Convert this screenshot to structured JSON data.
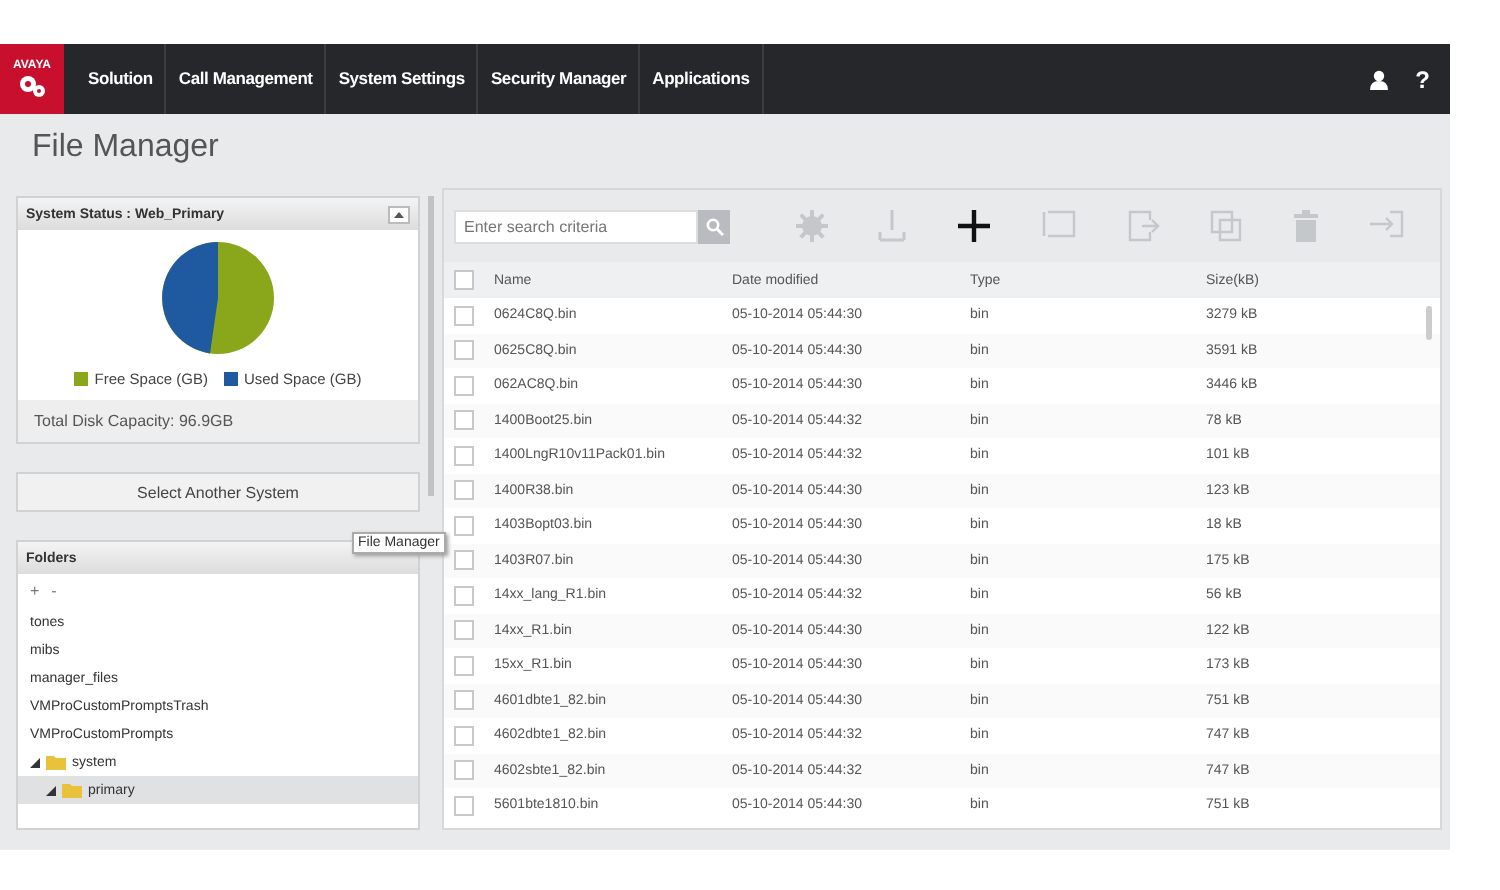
{
  "nav": {
    "logo": "AVAYA",
    "items": [
      "Solution",
      "Call Management",
      "System Settings",
      "Security Manager",
      "Applications"
    ],
    "help": "?"
  },
  "page_title": "File Manager",
  "status_panel": {
    "title": "System Status : Web_Primary",
    "legend": [
      {
        "label": "Free Space (GB)",
        "color": "#8aa61a"
      },
      {
        "label": "Used Space (GB)",
        "color": "#1f5aa0"
      }
    ],
    "total": "Total Disk Capacity: 96.9GB"
  },
  "select_button": "Select Another System",
  "folders": {
    "title": "Folders",
    "expand": "+",
    "collapse": "-",
    "items": [
      {
        "name": "tones",
        "selected": false
      },
      {
        "name": "mibs",
        "selected": false
      },
      {
        "name": "manager_files",
        "selected": false
      },
      {
        "name": "VMProCustomPromptsTrash",
        "selected": false
      },
      {
        "name": "VMProCustomPrompts",
        "selected": false
      },
      {
        "name": "system",
        "folder": true,
        "expanded": true,
        "selected": false,
        "children": [
          {
            "name": "primary",
            "folder": true,
            "expanded": true,
            "selected": true
          }
        ]
      }
    ]
  },
  "search": {
    "placeholder": "Enter search criteria"
  },
  "toolbar": [
    {
      "kind": "gear",
      "disabled": true
    },
    {
      "kind": "download",
      "disabled": true
    },
    {
      "kind": "add",
      "disabled": false
    },
    {
      "kind": "rename",
      "disabled": true
    },
    {
      "kind": "export",
      "disabled": true
    },
    {
      "kind": "copy",
      "disabled": true
    },
    {
      "kind": "delete",
      "disabled": true
    },
    {
      "kind": "logout",
      "disabled": true
    }
  ],
  "table": {
    "columns": [
      "Name",
      "Date modified",
      "Type",
      "Size(kB)"
    ],
    "header_checked": false,
    "rows": [
      {
        "name": "0624C8Q.bin",
        "date": "05-10-2014 05:44:30",
        "type": "bin",
        "size": "3279 kB",
        "checked": false
      },
      {
        "name": "0625C8Q.bin",
        "date": "05-10-2014 05:44:30",
        "type": "bin",
        "size": "3591 kB",
        "checked": false
      },
      {
        "name": "062AC8Q.bin",
        "date": "05-10-2014 05:44:30",
        "type": "bin",
        "size": "3446 kB",
        "checked": false
      },
      {
        "name": "1400Boot25.bin",
        "date": "05-10-2014 05:44:32",
        "type": "bin",
        "size": "78 kB",
        "checked": false
      },
      {
        "name": "1400LngR10v11Pack01.bin",
        "date": "05-10-2014 05:44:32",
        "type": "bin",
        "size": "101 kB",
        "checked": false
      },
      {
        "name": "1400R38.bin",
        "date": "05-10-2014 05:44:30",
        "type": "bin",
        "size": "123 kB",
        "checked": false
      },
      {
        "name": "1403Bopt03.bin",
        "date": "05-10-2014 05:44:30",
        "type": "bin",
        "size": "18 kB",
        "checked": false
      },
      {
        "name": "1403R07.bin",
        "date": "05-10-2014 05:44:30",
        "type": "bin",
        "size": "175 kB",
        "checked": false
      },
      {
        "name": "14xx_lang_R1.bin",
        "date": "05-10-2014 05:44:32",
        "type": "bin",
        "size": "56 kB",
        "checked": false
      },
      {
        "name": "14xx_R1.bin",
        "date": "05-10-2014 05:44:30",
        "type": "bin",
        "size": "122 kB",
        "checked": false
      },
      {
        "name": "15xx_R1.bin",
        "date": "05-10-2014 05:44:30",
        "type": "bin",
        "size": "173 kB",
        "checked": false
      },
      {
        "name": "4601dbte1_82.bin",
        "date": "05-10-2014 05:44:30",
        "type": "bin",
        "size": "751 kB",
        "checked": false
      },
      {
        "name": "4602dbte1_82.bin",
        "date": "05-10-2014 05:44:32",
        "type": "bin",
        "size": "747 kB",
        "checked": false
      },
      {
        "name": "4602sbte1_82.bin",
        "date": "05-10-2014 05:44:32",
        "type": "bin",
        "size": "747 kB",
        "checked": false
      },
      {
        "name": "5601bte1810.bin",
        "date": "05-10-2014 05:44:30",
        "type": "bin",
        "size": "751 kB",
        "checked": false
      }
    ]
  },
  "tooltip": "File Manager"
}
